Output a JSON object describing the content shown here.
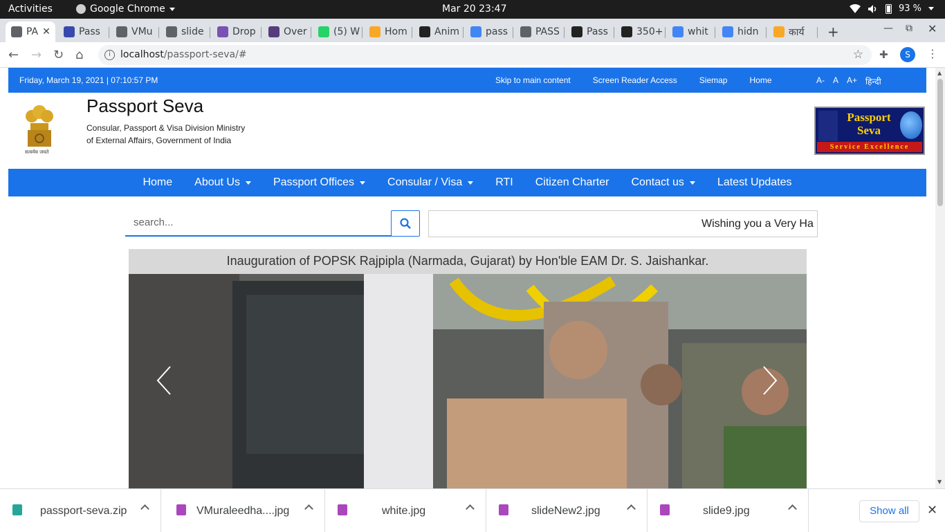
{
  "gnome": {
    "activities": "Activities",
    "app_name": "Google Chrome",
    "clock": "Mar 20  23:47",
    "battery": "93 %"
  },
  "tabs": [
    {
      "label": "PA",
      "favicon": "globe-icon",
      "color": "#5f6368",
      "active": true
    },
    {
      "label": "Pass",
      "favicon": "passport-icon",
      "color": "#3949ab"
    },
    {
      "label": "VMu",
      "favicon": "globe-icon",
      "color": "#5f6368"
    },
    {
      "label": "slide",
      "favicon": "globe-icon",
      "color": "#5f6368"
    },
    {
      "label": "Drop",
      "favicon": "bootstrap-icon",
      "color": "#7952b3"
    },
    {
      "label": "Over",
      "favicon": "bootstrap-icon",
      "color": "#563d7c"
    },
    {
      "label": "(5) W",
      "favicon": "whatsapp-icon",
      "color": "#25d366"
    },
    {
      "label": "Hom",
      "favicon": "gov-icon",
      "color": "#f9a825"
    },
    {
      "label": "Anim",
      "favicon": "diamond-icon",
      "color": "#222"
    },
    {
      "label": "pass",
      "favicon": "google-icon",
      "color": "#4285f4"
    },
    {
      "label": "PASS",
      "favicon": "globe-icon",
      "color": "#5f6368"
    },
    {
      "label": "Pass",
      "favicon": "stack-icon",
      "color": "#222"
    },
    {
      "label": "350+",
      "favicon": "stack-icon",
      "color": "#222"
    },
    {
      "label": "whit",
      "favicon": "google-icon",
      "color": "#4285f4"
    },
    {
      "label": "hidn",
      "favicon": "google-icon",
      "color": "#4285f4"
    },
    {
      "label": "कार्य",
      "favicon": "gov-icon",
      "color": "#f9a825"
    }
  ],
  "omnibox": {
    "host": "localhost",
    "path": "/passport-seva/#"
  },
  "profile_initial": "S",
  "site": {
    "datetime": "Friday, March 19, 2021 | 07:10:57 PM",
    "top_links": [
      "Skip to main content",
      "Screen Reader Access",
      "Siemap",
      "Home"
    ],
    "font_controls": [
      "A-",
      "A",
      "A+",
      "हिन्दी"
    ],
    "title": "Passport Seva",
    "subtitle_line1": "Consular, Passport & Visa Division Ministry",
    "subtitle_line2": "of External Affairs, Government of India",
    "emblem_motto": "सत्यमेव जयते",
    "logo_text_1": "Passport",
    "logo_text_2": "Seva",
    "logo_tagline": "Service Excellence",
    "nav": [
      {
        "label": "Home",
        "dropdown": false
      },
      {
        "label": "About Us",
        "dropdown": true
      },
      {
        "label": "Passport Offices",
        "dropdown": true
      },
      {
        "label": "Consular / Visa",
        "dropdown": true
      },
      {
        "label": "RTI",
        "dropdown": false
      },
      {
        "label": "Citizen Charter",
        "dropdown": false
      },
      {
        "label": "Contact us",
        "dropdown": true
      },
      {
        "label": "Latest Updates",
        "dropdown": false
      }
    ],
    "search_placeholder": "search...",
    "marquee_text": "Wishing you a Very Ha",
    "carousel_caption": "Inauguration of POPSK Rajpipla (Narmada, Gujarat) by Hon'ble EAM Dr. S. Jaishankar."
  },
  "downloads": [
    {
      "name": "passport-seva.zip",
      "icon": "archive-icon",
      "color": "#26a69a"
    },
    {
      "name": "VMuraleedha....jpg",
      "icon": "image-icon",
      "color": "#ab47bc"
    },
    {
      "name": "white.jpg",
      "icon": "image-icon",
      "color": "#ab47bc"
    },
    {
      "name": "slideNew2.jpg",
      "icon": "image-icon",
      "color": "#ab47bc"
    },
    {
      "name": "slide9.jpg",
      "icon": "image-icon",
      "color": "#ab47bc"
    }
  ],
  "show_all": "Show all"
}
